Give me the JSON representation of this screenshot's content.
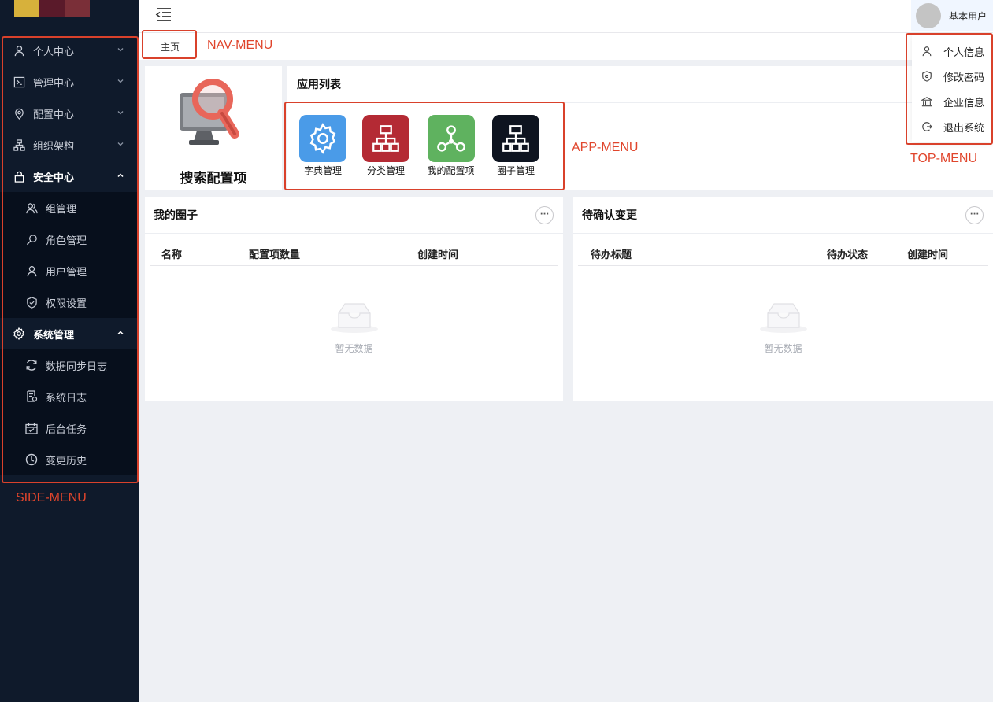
{
  "sidebar": {
    "items": [
      {
        "label": "个人中心",
        "icon": "user-icon"
      },
      {
        "label": "管理中心",
        "icon": "terminal-icon"
      },
      {
        "label": "配置中心",
        "icon": "location-pin-icon"
      },
      {
        "label": "组织架构",
        "icon": "org-chart-icon"
      },
      {
        "label": "安全中心",
        "icon": "lock-icon"
      },
      {
        "label": "系统管理",
        "icon": "gear-icon"
      }
    ],
    "security_sub": [
      {
        "label": "组管理",
        "icon": "group-icon"
      },
      {
        "label": "角色管理",
        "icon": "key-icon"
      },
      {
        "label": "用户管理",
        "icon": "user-icon"
      },
      {
        "label": "权限设置",
        "icon": "shield-icon"
      }
    ],
    "system_sub": [
      {
        "label": "数据同步日志",
        "icon": "sync-icon"
      },
      {
        "label": "系统日志",
        "icon": "log-icon"
      },
      {
        "label": "后台任务",
        "icon": "calendar-check-icon"
      },
      {
        "label": "变更历史",
        "icon": "clock-icon"
      }
    ]
  },
  "topbar": {
    "user_name": "基本用户",
    "dropdown": [
      {
        "label": "个人信息",
        "icon": "user-icon"
      },
      {
        "label": "修改密码",
        "icon": "shield-icon"
      },
      {
        "label": "企业信息",
        "icon": "bank-icon"
      },
      {
        "label": "退出系统",
        "icon": "logout-icon"
      }
    ]
  },
  "nav": {
    "home_tab": "主页"
  },
  "search_card": {
    "label": "搜索配置项"
  },
  "app_list": {
    "title": "应用列表",
    "apps": [
      {
        "label": "字典管理",
        "color": "#4a9be8",
        "icon": "gear-icon"
      },
      {
        "label": "分类管理",
        "color": "#b42a34",
        "icon": "hierarchy-icon"
      },
      {
        "label": "我的配置项",
        "color": "#5fb25f",
        "icon": "network-icon"
      },
      {
        "label": "圈子管理",
        "color": "#0e1420",
        "icon": "hierarchy-icon"
      }
    ]
  },
  "panels": {
    "my_circles": {
      "title": "我的圈子",
      "columns": [
        "名称",
        "配置项数量",
        "创建时间"
      ],
      "empty_text": "暂无数据"
    },
    "pending_changes": {
      "title": "待确认变更",
      "columns": [
        "待办标题",
        "待办状态",
        "创建时间"
      ],
      "empty_text": "暂无数据"
    }
  },
  "more_label": "···",
  "annotations": {
    "nav_menu": "NAV-MENU",
    "app_menu": "APP-MENU",
    "top_menu": "TOP-MENU",
    "side_menu": "SIDE-MENU"
  },
  "colors": {
    "annotation": "#d9412b",
    "sidebar_bg": "#0f1a2b"
  }
}
